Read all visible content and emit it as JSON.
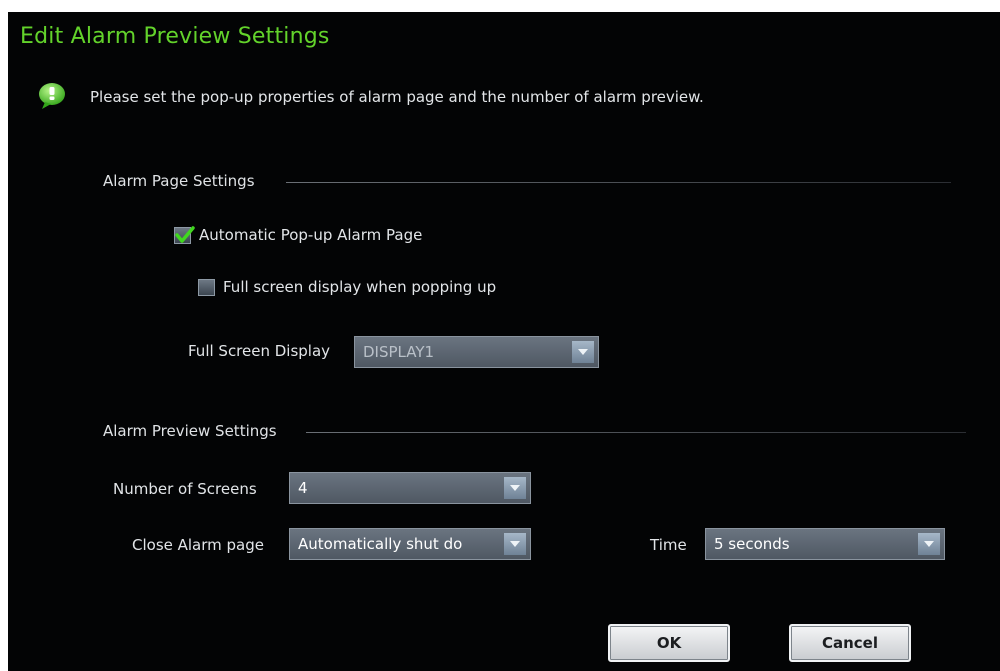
{
  "dialog": {
    "title": "Edit Alarm Preview Settings",
    "info_text": "Please set the pop-up properties of alarm page and the number of alarm preview."
  },
  "alarm_page_settings": {
    "section_label": "Alarm Page Settings",
    "auto_popup": {
      "label": "Automatic Pop-up Alarm Page",
      "checked": true
    },
    "full_screen_popup": {
      "label": "Full screen display when popping up",
      "checked": false
    },
    "full_screen_display": {
      "label": "Full Screen Display",
      "value": "DISPLAY1",
      "enabled": false
    }
  },
  "alarm_preview_settings": {
    "section_label": "Alarm Preview Settings",
    "number_of_screens": {
      "label": "Number of Screens",
      "value": "4"
    },
    "close_alarm_page": {
      "label": "Close Alarm page",
      "value": "Automatically  shut do"
    },
    "time": {
      "label": "Time",
      "value": "5 seconds"
    }
  },
  "buttons": {
    "ok": "OK",
    "cancel": "Cancel"
  },
  "colors": {
    "title": "#63d32b",
    "background": "#030405",
    "info_icon": "#4fd12a"
  },
  "icons": {
    "info": "info-bubble-icon",
    "dropdown": "chevron-down-icon",
    "check": "checkmark-icon"
  }
}
